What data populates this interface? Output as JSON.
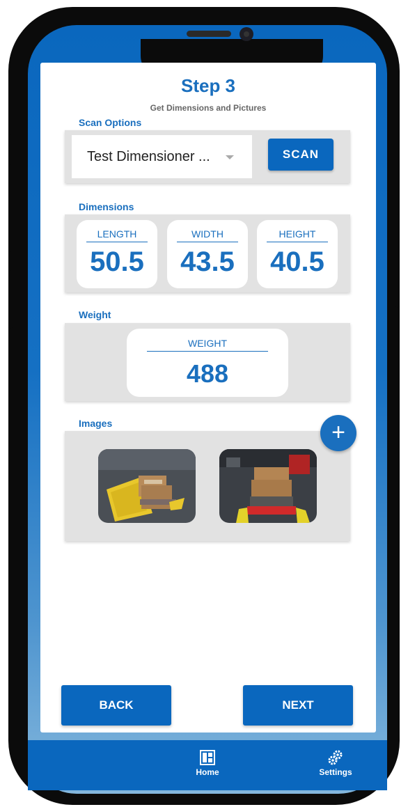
{
  "header": {
    "title": "Step 3",
    "subtitle": "Get Dimensions and Pictures"
  },
  "scan_options": {
    "label": "Scan Options",
    "selected": "Test Dimensioner ...",
    "scan_label": "SCAN"
  },
  "dimensions": {
    "label": "Dimensions",
    "items": [
      {
        "label": "LENGTH",
        "value": "50.5"
      },
      {
        "label": "WIDTH",
        "value": "43.5"
      },
      {
        "label": "HEIGHT",
        "value": "40.5"
      }
    ]
  },
  "weight": {
    "label": "Weight",
    "box_label": "WEIGHT",
    "value": "488"
  },
  "images": {
    "label": "Images",
    "add_glyph": "+"
  },
  "footer": {
    "back_label": "BACK",
    "next_label": "NEXT"
  },
  "tabbar": {
    "home_label": "Home",
    "settings_label": "Settings"
  },
  "colors": {
    "accent": "#1a6fbe",
    "button": "#0a67be",
    "panel": "#e2e2e2"
  }
}
